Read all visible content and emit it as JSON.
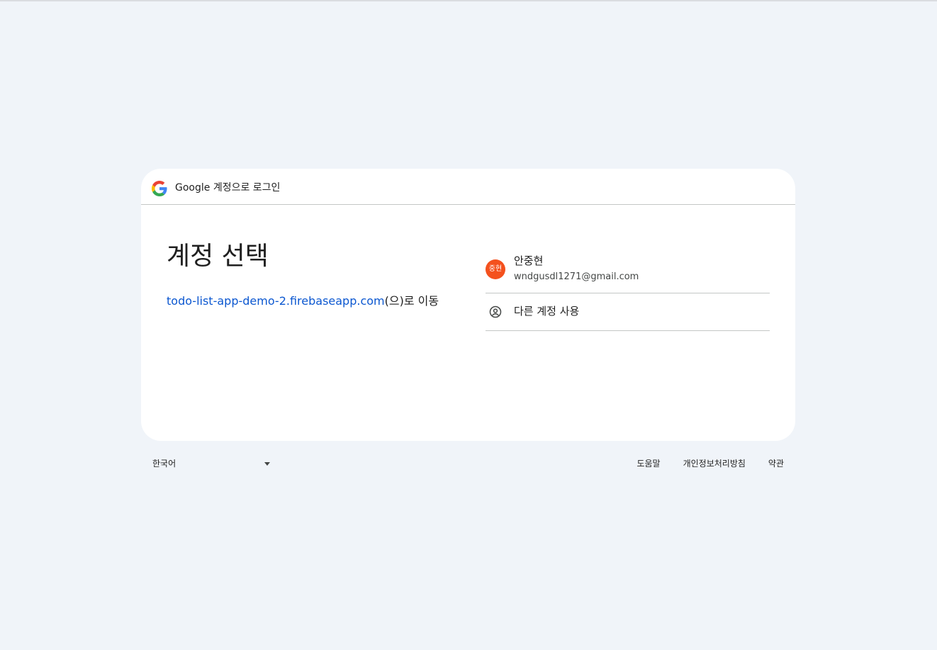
{
  "header": {
    "google_label": "Google 계정으로 로그인"
  },
  "main": {
    "title": "계정 선택",
    "destination_link": "todo-list-app-demo-2.firebaseapp.com",
    "destination_suffix": "(으)로 이동"
  },
  "accounts": [
    {
      "avatar_text": "중현",
      "avatar_color": "#f4511e",
      "name": "안중현",
      "email": "wndgusdl1271@gmail.com"
    }
  ],
  "other_account": {
    "label": "다른 계정 사용",
    "icon": "account-circle-icon"
  },
  "footer": {
    "language": "한국어",
    "links": [
      "도움말",
      "개인정보처리방침",
      "약관"
    ]
  },
  "colors": {
    "background": "#f0f4f9",
    "link": "#0b57d0",
    "avatar": "#f4511e"
  }
}
